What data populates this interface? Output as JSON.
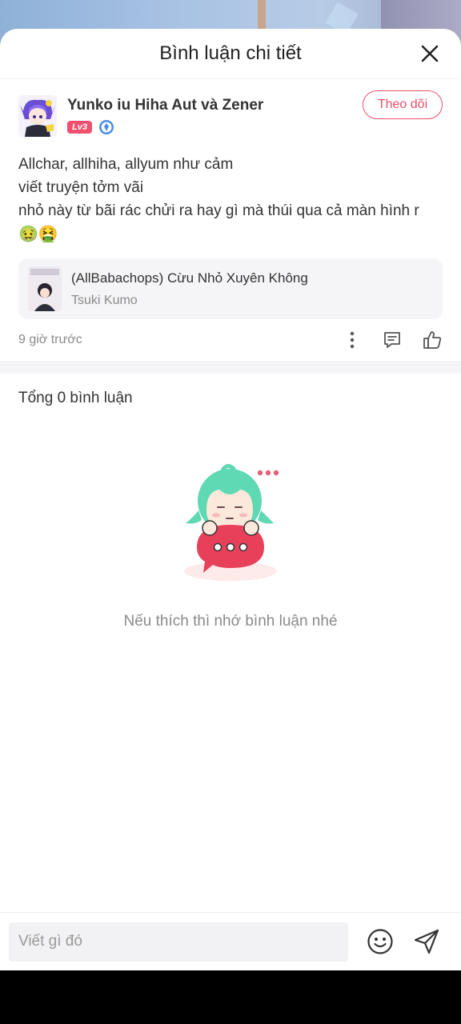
{
  "header": {
    "title": "Bình luận chi tiết"
  },
  "post": {
    "author_name": "Yunko iu Hiha Aut và Zener",
    "level_badge": "Lv3",
    "follow_label": "Theo dõi",
    "content": "Allchar, allhiha, allyum như cảm\nviết truyện tởm vãi\nnhỏ này từ bãi rác chửi ra hay gì mà thúi qua cả màn hình r",
    "emojis": "🤢🤮",
    "book": {
      "title": "(AllBabachops) Cừu Nhỏ Xuyên Không",
      "author": "Tsuki Kumo"
    },
    "time": "9 giờ trước"
  },
  "comments": {
    "total_label": "Tổng 0 bình luận",
    "empty_text": "Nếu thích thì nhớ bình luận nhé"
  },
  "input": {
    "placeholder": "Viết gì đó",
    "value": ""
  },
  "colors": {
    "accent": "#e8506c",
    "level_badge": "#f0506e",
    "mascot_hair": "#5fd8b4",
    "mascot_bubble": "#e8405a"
  },
  "icons": [
    "close-icon",
    "shield-badge-icon",
    "more-vertical-icon",
    "comment-icon",
    "thumbs-up-icon",
    "emoji-icon",
    "send-icon"
  ]
}
